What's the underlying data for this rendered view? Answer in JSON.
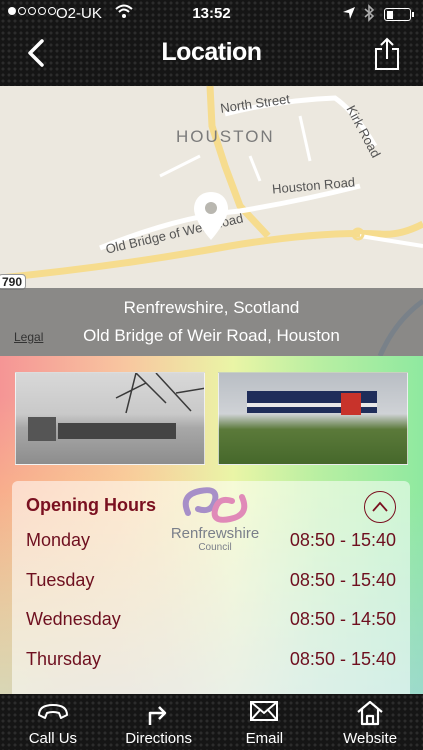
{
  "status_bar": {
    "carrier": "O2-UK",
    "time": "13:52",
    "signal_bars": 1,
    "battery_level": 0.3
  },
  "nav": {
    "title": "Location",
    "back_icon": "chevron-left-icon",
    "share_icon": "share-icon"
  },
  "map": {
    "streets": {
      "north_street": "North Street",
      "kirk_road": "Kirk Road",
      "houston_road": "Houston Road",
      "old_bridge_road": "Old Bridge of Weir Road"
    },
    "town": "HOUSTON",
    "road_number": "790",
    "legal": "Legal",
    "address_line1": "Renfrewshire, Scotland",
    "address_line2": "Old Bridge of Weir Road, Houston"
  },
  "opening_hours": {
    "title": "Opening Hours",
    "logo_name": "Renfrewshire",
    "logo_sub": "Council",
    "days": [
      {
        "day": "Monday",
        "hours": "08:50 - 15:40"
      },
      {
        "day": "Tuesday",
        "hours": "08:50 - 15:40"
      },
      {
        "day": "Wednesday",
        "hours": "08:50 - 14:50"
      },
      {
        "day": "Thursday",
        "hours": "08:50 - 15:40"
      }
    ]
  },
  "tabs": [
    {
      "label": "Call Us",
      "icon": "phone-icon"
    },
    {
      "label": "Directions",
      "icon": "directions-arrow-icon"
    },
    {
      "label": "Email",
      "icon": "envelope-icon"
    },
    {
      "label": "Website",
      "icon": "home-icon"
    }
  ],
  "colors": {
    "accent_text": "#7a1020",
    "header_bg": "#151515",
    "map_road": "#f6dc8e"
  }
}
